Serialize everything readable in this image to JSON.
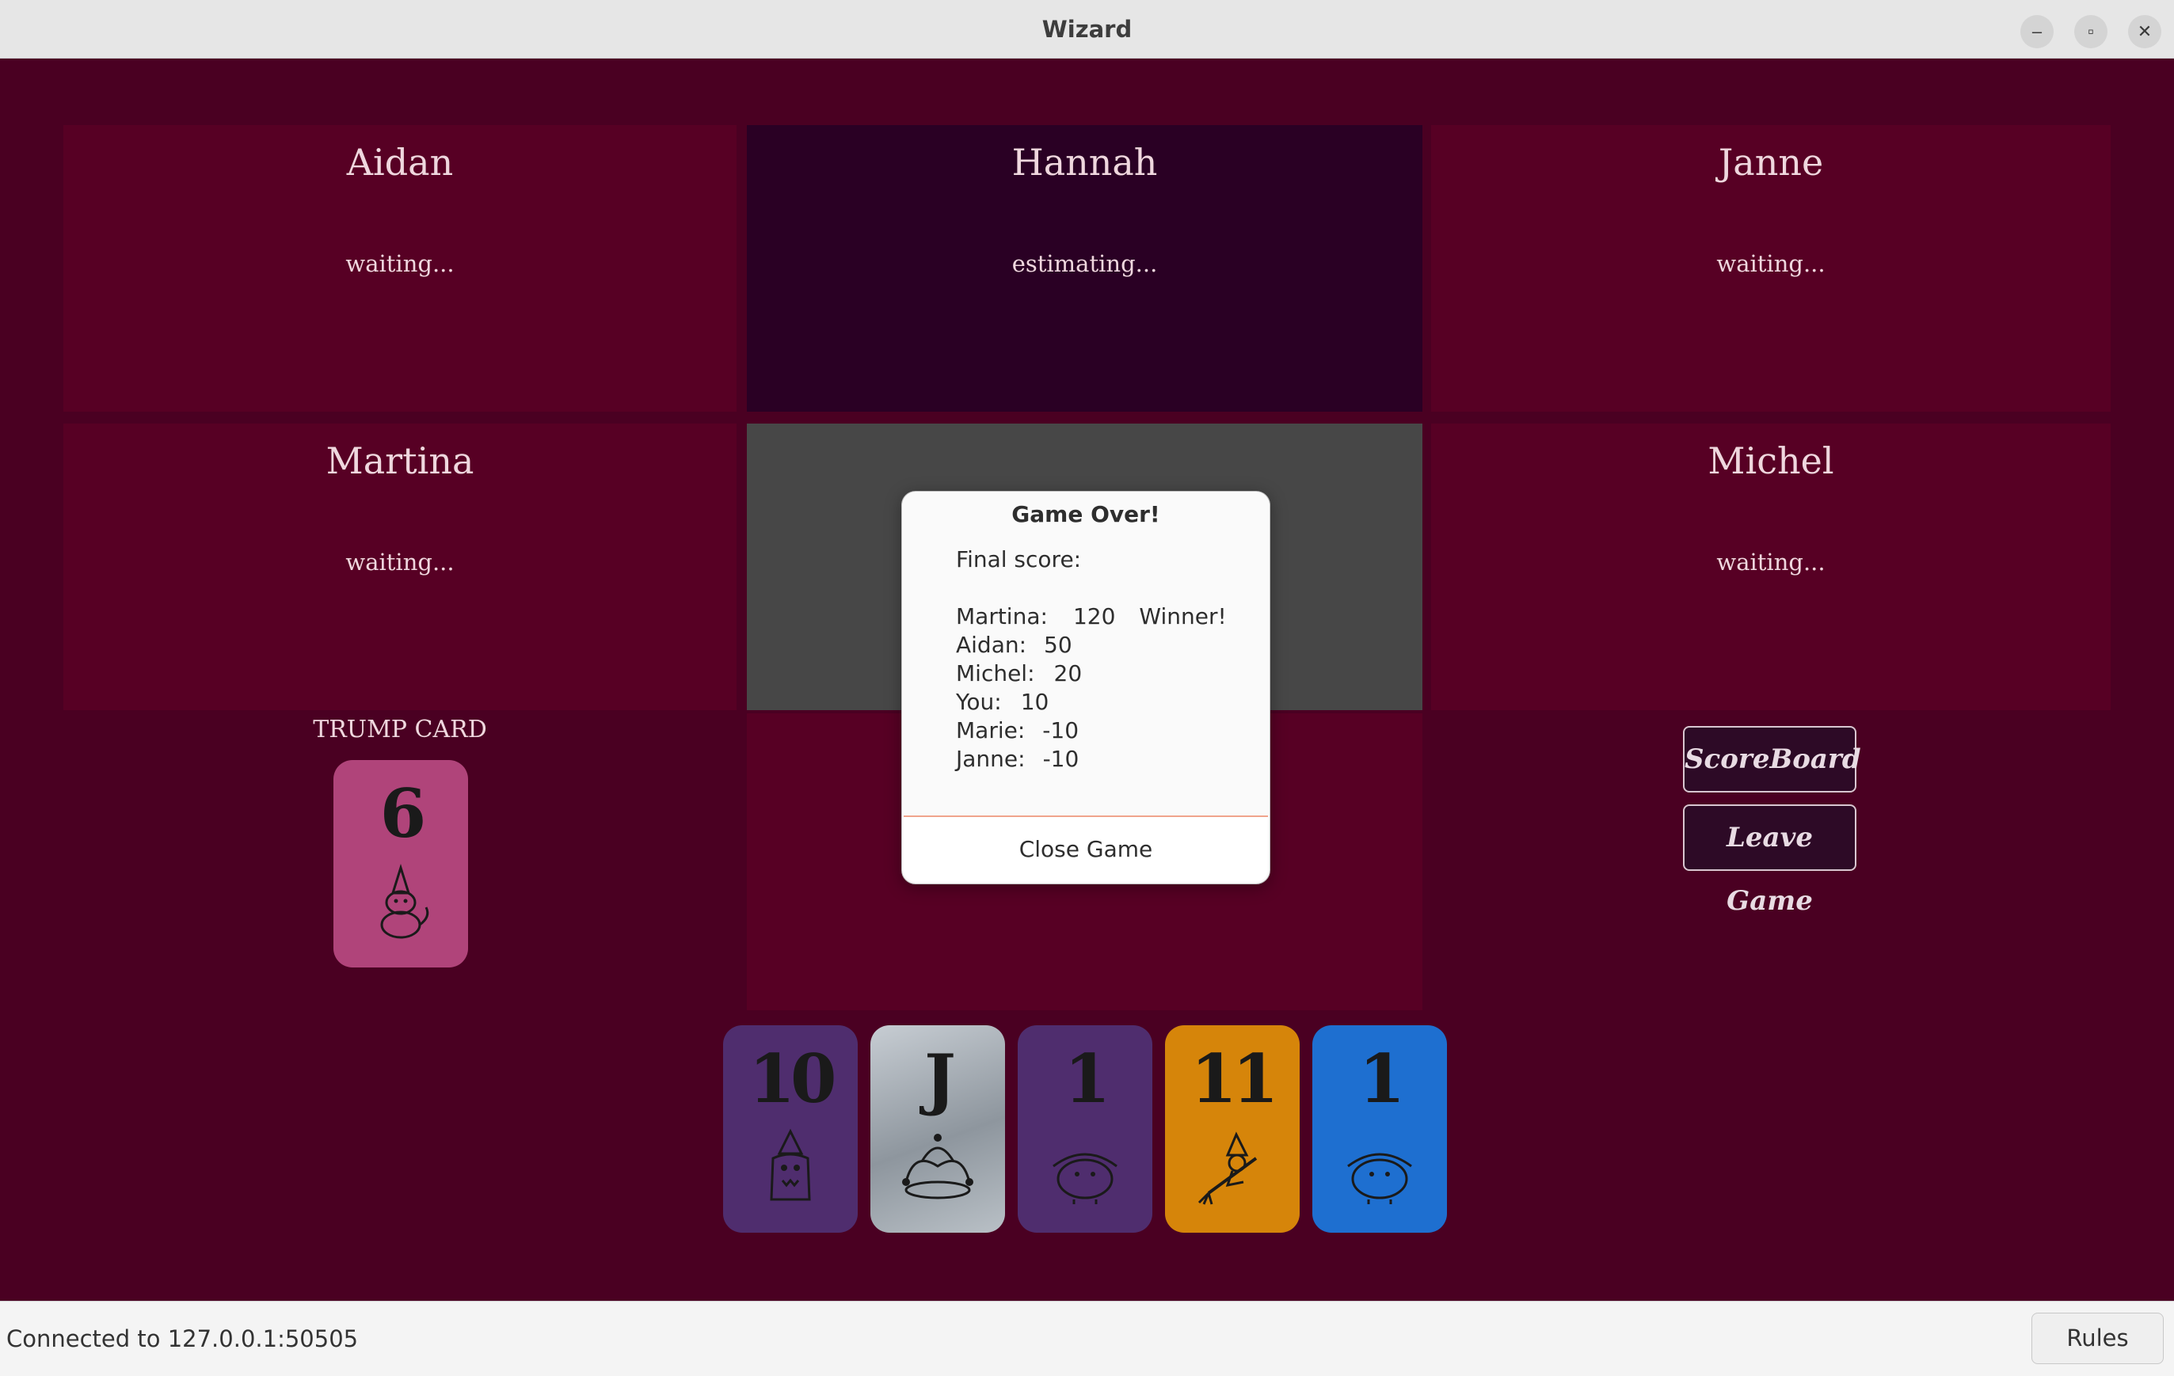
{
  "window": {
    "title": "Wizard"
  },
  "players": [
    {
      "name": "Aidan",
      "status": "waiting..."
    },
    {
      "name": "Hannah",
      "status": "estimating..."
    },
    {
      "name": "Janne",
      "status": "waiting..."
    },
    {
      "name": "Martina",
      "status": "waiting..."
    },
    {
      "name": "Michel",
      "status": "waiting..."
    }
  ],
  "trump": {
    "label": "TRUMP CARD",
    "value": "6",
    "color": "#b0447a",
    "icon": "cat-wizard-icon"
  },
  "hand": [
    {
      "value": "10",
      "color": "#4f2d6e",
      "icon": "monster-wizard-icon"
    },
    {
      "value": "J",
      "color": "#9aa0a6",
      "icon": "jester-hat-icon"
    },
    {
      "value": "1",
      "color": "#4f2d6e",
      "icon": "blob-creature-icon"
    },
    {
      "value": "11",
      "color": "#d6850a",
      "icon": "witch-broom-icon"
    },
    {
      "value": "1",
      "color": "#1e6fd0",
      "icon": "blob-creature-icon"
    }
  ],
  "side_buttons": {
    "scoreboard": "ScoreBoard",
    "leave": "Leave Game"
  },
  "dialog": {
    "title": "Game Over!",
    "heading": "Final score:",
    "scores": [
      {
        "name": "Martina:",
        "score": "120",
        "note": "Winner!"
      },
      {
        "name": "Aidan:",
        "score": "50",
        "note": ""
      },
      {
        "name": "Michel:",
        "score": "20",
        "note": ""
      },
      {
        "name": "You:",
        "score": "10",
        "note": ""
      },
      {
        "name": "Marie:",
        "score": "-10",
        "note": ""
      },
      {
        "name": "Janne:",
        "score": "-10",
        "note": ""
      }
    ],
    "close_label": "Close Game"
  },
  "statusbar": {
    "text": "Connected to 127.0.0.1:50505",
    "rules_label": "Rules"
  }
}
